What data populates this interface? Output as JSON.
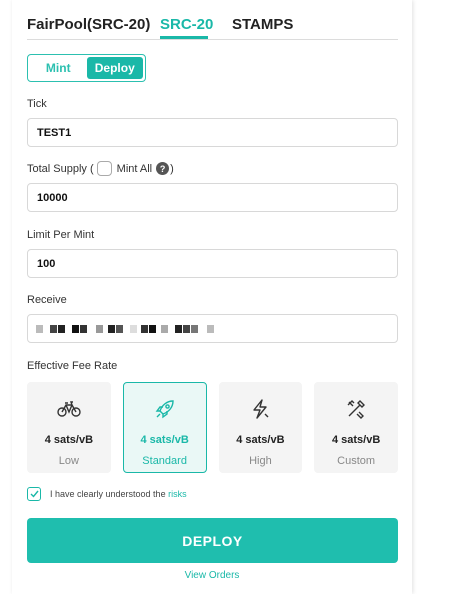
{
  "tabs": [
    {
      "label": "FairPool(SRC-20)",
      "active": false
    },
    {
      "label": "SRC-20",
      "active": true
    },
    {
      "label": "STAMPS",
      "active": false
    }
  ],
  "mode": {
    "mint_label": "Mint",
    "deploy_label": "Deploy",
    "selected": "Deploy"
  },
  "tick": {
    "label": "Tick",
    "value": "TEST1"
  },
  "supply": {
    "label_prefix": "Total Supply (",
    "mint_all_label": "Mint All",
    "help": "?",
    "label_suffix": ")",
    "value": "10000",
    "mint_all_checked": false
  },
  "limit": {
    "label": "Limit Per Mint",
    "value": "100"
  },
  "receive": {
    "label": "Receive",
    "value_masked": true
  },
  "fee": {
    "label": "Effective Fee Rate",
    "options": [
      {
        "rate": "4 sats/vB",
        "name": "Low",
        "icon": "bicycle-icon",
        "selected": false
      },
      {
        "rate": "4 sats/vB",
        "name": "Standard",
        "icon": "rocket-icon",
        "selected": true
      },
      {
        "rate": "4 sats/vB",
        "name": "High",
        "icon": "flash-icon",
        "selected": false
      },
      {
        "rate": "4 sats/vB",
        "name": "Custom",
        "icon": "tools-icon",
        "selected": false
      }
    ]
  },
  "agreement": {
    "text": "I have clearly understood the ",
    "link": "risks",
    "checked": true
  },
  "actions": {
    "deploy_label": "DEPLOY",
    "view_orders_label": "View Orders"
  },
  "colors": {
    "accent": "#1ab8a8",
    "button": "#1fbeae"
  }
}
